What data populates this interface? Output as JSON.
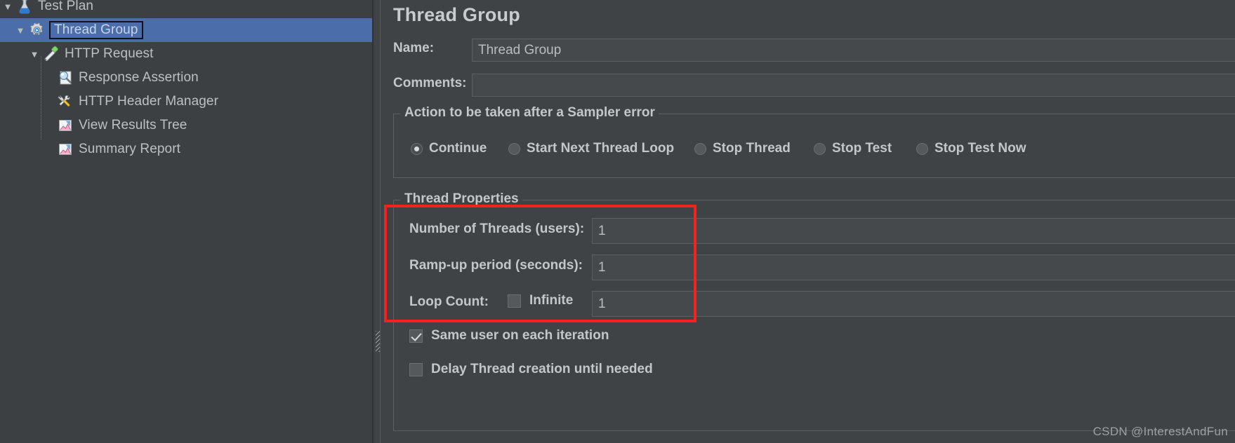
{
  "tree": {
    "items": [
      {
        "label": "Test Plan",
        "icon": "flask-icon",
        "indent": 0,
        "twisty": "down",
        "selected": false
      },
      {
        "label": "Thread Group",
        "icon": "gear-icon",
        "indent": 1,
        "twisty": "down",
        "selected": true
      },
      {
        "label": "HTTP Request",
        "icon": "pipette-icon",
        "indent": 2,
        "twisty": "down",
        "selected": false
      },
      {
        "label": "Response Assertion",
        "icon": "magnifier-icon",
        "indent": 3,
        "twisty": "none",
        "selected": false
      },
      {
        "label": "HTTP Header Manager",
        "icon": "tools-icon",
        "indent": 3,
        "twisty": "none",
        "selected": false
      },
      {
        "label": "View Results Tree",
        "icon": "chart-pink-icon",
        "indent": 3,
        "twisty": "none",
        "selected": false
      },
      {
        "label": "Summary Report",
        "icon": "chart-pink-icon",
        "indent": 3,
        "twisty": "none",
        "selected": false
      }
    ]
  },
  "panel": {
    "title": "Thread Group",
    "name_label": "Name:",
    "name_value": "Thread Group",
    "comments_label": "Comments:",
    "comments_value": ""
  },
  "sampler_error": {
    "group_title": "Action to be taken after a Sampler error",
    "options": [
      {
        "label": "Continue",
        "checked": true
      },
      {
        "label": "Start Next Thread Loop",
        "checked": false
      },
      {
        "label": "Stop Thread",
        "checked": false
      },
      {
        "label": "Stop Test",
        "checked": false
      },
      {
        "label": "Stop Test Now",
        "checked": false
      }
    ]
  },
  "thread_properties": {
    "group_title": "Thread Properties",
    "num_threads_label": "Number of Threads (users):",
    "num_threads_value": "1",
    "ramp_up_label": "Ramp-up period (seconds):",
    "ramp_up_value": "1",
    "loop_count_label": "Loop Count:",
    "infinite_label": "Infinite",
    "infinite_checked": false,
    "loop_count_value": "1",
    "same_user_label": "Same user on each iteration",
    "same_user_checked": true,
    "delay_thread_label": "Delay Thread creation until needed",
    "delay_thread_checked": false
  },
  "annotation": {
    "highlight_color": "#f4211f"
  },
  "watermark": {
    "text": "CSDN @InterestAndFun"
  },
  "colors": {
    "background": "#3f4345",
    "selection": "#4b6eaa",
    "field": "#46494b",
    "text": "#c3c7c8",
    "border": "#5d6163"
  }
}
